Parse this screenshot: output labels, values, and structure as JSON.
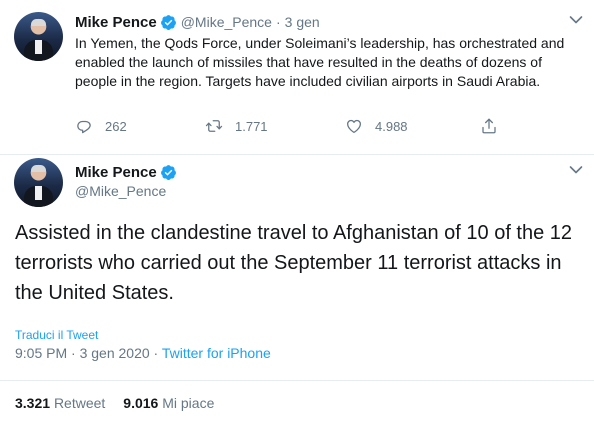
{
  "tweet1": {
    "name": "Mike Pence",
    "handle": "@Mike_Pence",
    "separator": "·",
    "time": "3 gen",
    "text": "In Yemen, the Qods Force, under Soleimani’s leadership, has orchestrated and enabled the launch of missiles that have resulted in the deaths of dozens of people in the region.  Targets have included civilian airports in Saudi Arabia.",
    "replies": "262",
    "retweets": "1.771",
    "likes": "4.988"
  },
  "tweet2": {
    "name": "Mike Pence",
    "handle": "@Mike_Pence",
    "text": "Assisted in the clandestine travel to Afghanistan of 10 of the 12 terrorists who carried out the September 11 terrorist attacks in the United States.",
    "translate_label": "Traduci il Tweet",
    "timestamp": "9:05 PM · 3 gen 2020 · ",
    "source": "Twitter for iPhone",
    "retweet_count": "3.321",
    "retweet_label": "Retweet",
    "like_count": "9.016",
    "like_label": "Mi piace"
  },
  "colors": {
    "accent": "#1da1f2",
    "secondary_text": "#657786",
    "primary_text": "#14171a",
    "divider": "#e6ecf0"
  },
  "icons": [
    "verified-badge-icon",
    "chevron-down-icon",
    "reply-icon",
    "retweet-icon",
    "like-icon",
    "share-icon"
  ]
}
